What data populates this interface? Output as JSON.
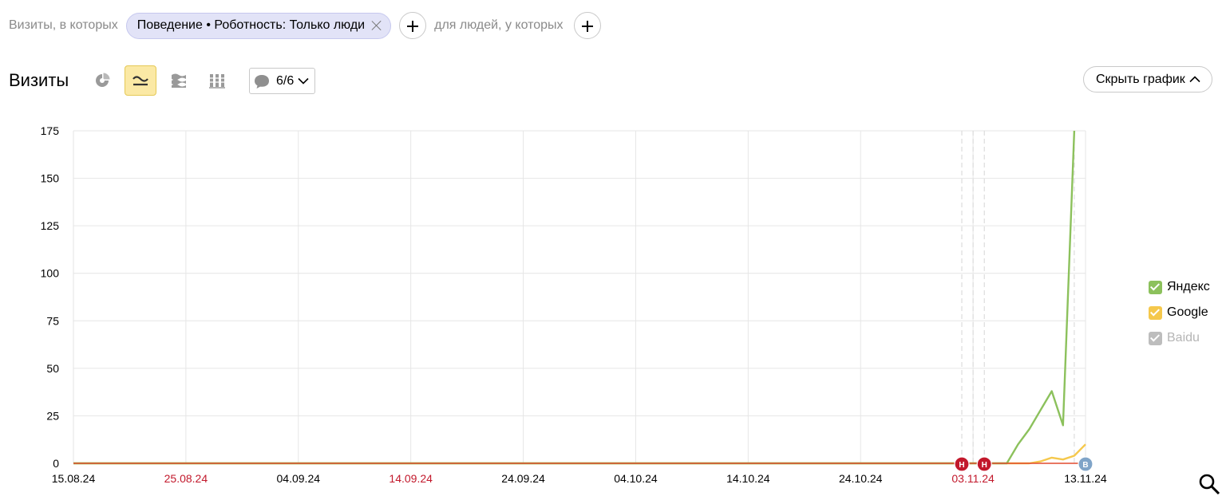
{
  "filters": {
    "visits_prefix": "Визиты, в которых",
    "chip_label": "Поведение • Роботность: Только люди",
    "people_prefix": "для людей, у которых"
  },
  "toolbar": {
    "title": "Визиты",
    "notes_count": "6/6",
    "hide_chart": "Скрыть график"
  },
  "icons": {
    "pie": "pie-chart-icon",
    "line": "line-chart-icon",
    "area": "area-chart-icon",
    "bar": "bar-chart-icon",
    "notes": "comment-icon",
    "chevron_down": "chevron-down-icon",
    "chevron_up": "chevron-up-icon",
    "zoom": "search-icon",
    "remove": "close-icon",
    "add": "plus-icon"
  },
  "chart_data": {
    "type": "line",
    "ylim": [
      0,
      175
    ],
    "yticks": [
      0,
      25,
      50,
      75,
      100,
      125,
      150,
      175
    ],
    "x_start": "2024-08-15",
    "x_end": "2024-11-13",
    "xtick_labels": [
      {
        "date": "2024-08-15",
        "label": "15.08.24",
        "holiday": false
      },
      {
        "date": "2024-08-25",
        "label": "25.08.24",
        "holiday": true
      },
      {
        "date": "2024-09-04",
        "label": "04.09.24",
        "holiday": false
      },
      {
        "date": "2024-09-14",
        "label": "14.09.24",
        "holiday": true
      },
      {
        "date": "2024-09-24",
        "label": "24.09.24",
        "holiday": false
      },
      {
        "date": "2024-10-04",
        "label": "04.10.24",
        "holiday": false
      },
      {
        "date": "2024-10-14",
        "label": "14.10.24",
        "holiday": false
      },
      {
        "date": "2024-10-24",
        "label": "24.10.24",
        "holiday": false
      },
      {
        "date": "2024-11-03",
        "label": "03.11.24",
        "holiday": true
      },
      {
        "date": "2024-11-13",
        "label": "13.11.24",
        "holiday": false
      }
    ],
    "grid": true,
    "legend_position": "right",
    "colors": {
      "baseline": "#e24a2e",
      "holiday_text": "#c2182b"
    },
    "series": [
      {
        "name": "Яндекс",
        "color": "#8cc15c",
        "enabled": true,
        "points": [
          {
            "x": "2024-08-15",
            "y": 0
          },
          {
            "x": "2024-11-06",
            "y": 0
          },
          {
            "x": "2024-11-07",
            "y": 10
          },
          {
            "x": "2024-11-08",
            "y": 18
          },
          {
            "x": "2024-11-09",
            "y": 28
          },
          {
            "x": "2024-11-10",
            "y": 38
          },
          {
            "x": "2024-11-11",
            "y": 20
          },
          {
            "x": "2024-11-12",
            "y": 175
          }
        ]
      },
      {
        "name": "Google",
        "color": "#f5c84c",
        "enabled": true,
        "points": [
          {
            "x": "2024-08-15",
            "y": 0
          },
          {
            "x": "2024-11-08",
            "y": 0
          },
          {
            "x": "2024-11-09",
            "y": 1
          },
          {
            "x": "2024-11-10",
            "y": 3
          },
          {
            "x": "2024-11-11",
            "y": 2
          },
          {
            "x": "2024-11-12",
            "y": 4
          },
          {
            "x": "2024-11-13",
            "y": 10
          }
        ]
      },
      {
        "name": "Baidu",
        "color": "#bdbdbd",
        "enabled": false,
        "points": [
          {
            "x": "2024-08-15",
            "y": 0
          },
          {
            "x": "2024-11-13",
            "y": 0
          }
        ]
      }
    ],
    "annotations": [
      {
        "date": "2024-11-02",
        "label": "Н",
        "color": "#c2182b"
      },
      {
        "date": "2024-11-04",
        "label": "Н",
        "color": "#c2182b"
      },
      {
        "date": "2024-11-13",
        "label": "В",
        "color": "#7fa4c8"
      }
    ],
    "highlight_dates": [
      "2024-11-02",
      "2024-11-03",
      "2024-11-04",
      "2024-11-12"
    ]
  }
}
